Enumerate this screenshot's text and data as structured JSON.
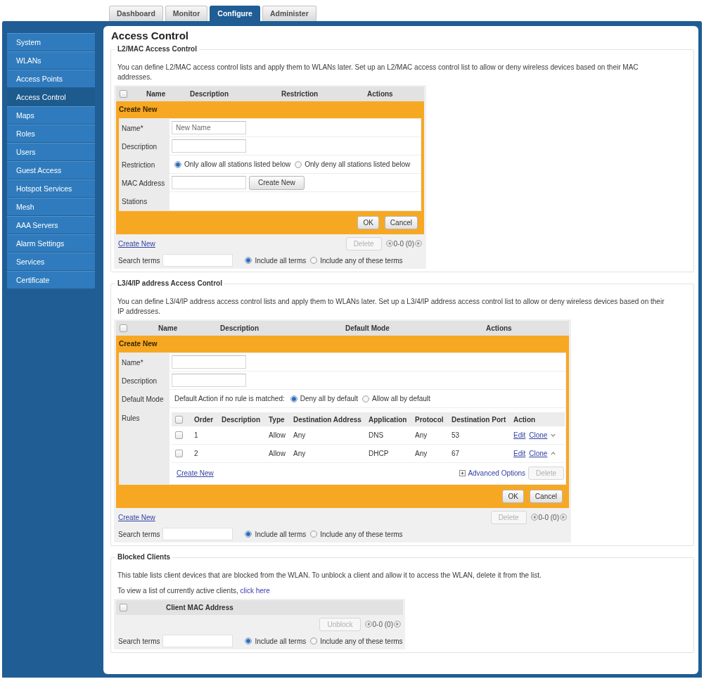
{
  "tabs": [
    {
      "label": "Dashboard",
      "selected": false
    },
    {
      "label": "Monitor",
      "selected": false
    },
    {
      "label": "Configure",
      "selected": true
    },
    {
      "label": "Administer",
      "selected": false
    }
  ],
  "sidebar": {
    "items": [
      {
        "label": "System",
        "selected": false
      },
      {
        "label": "WLANs",
        "selected": false
      },
      {
        "label": "Access Points",
        "selected": false
      },
      {
        "label": "Access Control",
        "selected": true
      },
      {
        "label": "Maps",
        "selected": false
      },
      {
        "label": "Roles",
        "selected": false
      },
      {
        "label": "Users",
        "selected": false
      },
      {
        "label": "Guest Access",
        "selected": false
      },
      {
        "label": "Hotspot Services",
        "selected": false
      },
      {
        "label": "Mesh",
        "selected": false
      },
      {
        "label": "AAA Servers",
        "selected": false
      },
      {
        "label": "Alarm Settings",
        "selected": false
      },
      {
        "label": "Services",
        "selected": false
      },
      {
        "label": "Certificate",
        "selected": false
      }
    ]
  },
  "page_title": "Access Control",
  "sections": [
    {
      "legend": "L2/MAC Access Control",
      "paragraphs": [
        {
          "text": "You can define L2/MAC access control lists and apply them to WLANs later. Set up an L2/MAC access control list to allow or deny wireless devices based on their MAC addresses."
        }
      ],
      "table": {
        "select_all": {
          "checked": false
        },
        "columns": [
          "Name",
          "Description",
          "Restriction",
          "Actions"
        ]
      },
      "create_form": {
        "title": "Create New",
        "fields": [
          {
            "kind": "input",
            "label": "Name*",
            "placeholder": "New Name"
          },
          {
            "kind": "input",
            "label": "Description"
          },
          {
            "kind": "radio",
            "label": "Restriction",
            "options": [
              {
                "label": "Only allow all stations listed below",
                "selected": true
              },
              {
                "label": "Only deny all stations listed below",
                "selected": false
              }
            ]
          },
          {
            "kind": "input_button",
            "label": "MAC Address",
            "button": "Create New"
          },
          {
            "kind": "empty",
            "label": "Stations"
          }
        ],
        "buttons": [
          "OK",
          "Cancel"
        ]
      },
      "create_link": "Create New",
      "action_button": {
        "label": "Delete",
        "disabled": true
      },
      "pager": "0-0 (0)",
      "search": {
        "label": "Search terms",
        "options": [
          {
            "label": "Include all terms",
            "selected": true
          },
          {
            "label": "Include any of these terms",
            "selected": false
          }
        ]
      }
    },
    {
      "legend": "L3/4/IP address Access Control",
      "paragraphs": [
        {
          "text": "You can define L3/4/IP address access control lists and apply them to WLANs later. Set up a L3/4/IP address access control list to allow or deny wireless devices based on their IP addresses."
        }
      ],
      "table": {
        "select_all": {
          "checked": false
        },
        "columns": [
          "Name",
          "Description",
          "Default Mode",
          "Actions"
        ]
      },
      "create_form": {
        "title": "Create New",
        "fields": [
          {
            "kind": "input",
            "label": "Name*"
          },
          {
            "kind": "input",
            "label": "Description"
          },
          {
            "kind": "radio",
            "label": "Default Mode",
            "prompt": "Default Action if no rule is matched:",
            "options": [
              {
                "label": "Deny all by default",
                "selected": true
              },
              {
                "label": "Allow all by default",
                "selected": false
              }
            ]
          },
          {
            "kind": "rules",
            "label": "Rules",
            "select_all": {
              "checked": false
            },
            "columns": [
              "Order",
              "Description",
              "Type",
              "Destination Address",
              "Application",
              "Protocol",
              "Destination Port",
              "Action"
            ],
            "rows": [
              {
                "checked": false,
                "order": "1",
                "type": "Allow",
                "destination_address": "Any",
                "application": "DNS",
                "protocol": "Any",
                "destination_port": "53",
                "actions": [
                  "Edit",
                  "Clone"
                ]
              },
              {
                "checked": false,
                "order": "2",
                "type": "Allow",
                "destination_address": "Any",
                "application": "DHCP",
                "protocol": "Any",
                "destination_port": "67",
                "actions": [
                  "Edit",
                  "Clone"
                ]
              }
            ],
            "create_link": "Create New",
            "options_link": "Advanced Options",
            "button": {
              "label": "Delete",
              "disabled": true
            }
          }
        ],
        "buttons": [
          "OK",
          "Cancel"
        ]
      },
      "create_link": "Create New",
      "action_button": {
        "label": "Delete",
        "disabled": true
      },
      "pager": "0-0 (0)",
      "search": {
        "label": "Search terms",
        "options": [
          {
            "label": "Include all terms",
            "selected": true
          },
          {
            "label": "Include any of these terms",
            "selected": false
          }
        ]
      }
    },
    {
      "legend": "Blocked Clients",
      "paragraphs": [
        {
          "text": "This table lists client devices that are blocked from the WLAN. To unblock a client and allow it to access the WLAN, delete it from the list."
        },
        {
          "text": "To view a list of currently active clients,",
          "link": "click here"
        }
      ],
      "table": {
        "select_all": {
          "checked": false
        },
        "columns": [
          "Client MAC Address"
        ]
      },
      "action_button": {
        "label": "Unblock",
        "disabled": true
      },
      "pager": "0-0 (0)",
      "search": {
        "label": "Search terms",
        "options": [
          {
            "label": "Include all terms",
            "selected": true
          },
          {
            "label": "Include any of these terms",
            "selected": false
          }
        ]
      }
    }
  ]
}
